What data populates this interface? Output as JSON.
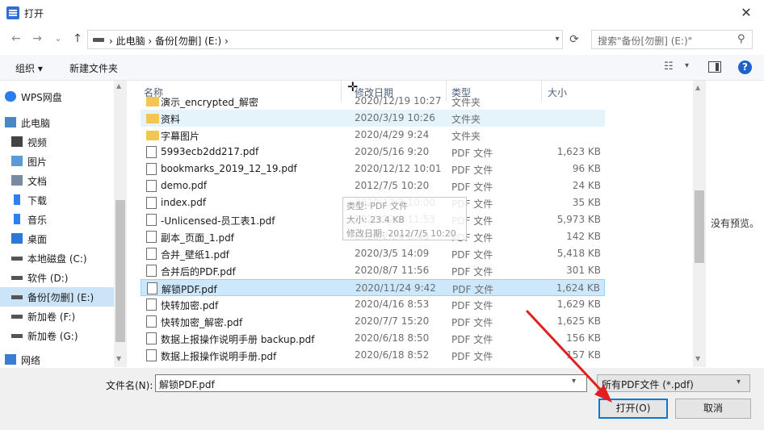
{
  "window": {
    "title": "打开",
    "close_glyph": "✕"
  },
  "nav": {
    "back_glyph": "←",
    "forward_glyph": "→",
    "recent_glyph": "⌄",
    "up_glyph": "↑",
    "breadcrumb": "›  此电脑  ›  备份[勿删] (E:)  ›",
    "search_placeholder": "搜索\"备份[勿删] (E:)\"",
    "refresh_glyph": "⟳"
  },
  "toolbar": {
    "organize": "组织 ▾",
    "new_folder": "新建文件夹"
  },
  "sidebar": {
    "items": [
      {
        "label": "WPS网盘",
        "icon": "cloud-icon"
      },
      {
        "label": "此电脑",
        "icon": "computer-icon"
      },
      {
        "label": "视频",
        "icon": "video-icon"
      },
      {
        "label": "图片",
        "icon": "pictures-icon"
      },
      {
        "label": "文档",
        "icon": "documents-icon"
      },
      {
        "label": "下载",
        "icon": "download-icon"
      },
      {
        "label": "音乐",
        "icon": "music-icon"
      },
      {
        "label": "桌面",
        "icon": "desktop-icon"
      },
      {
        "label": "本地磁盘 (C:)",
        "icon": "drive-icon"
      },
      {
        "label": "软件 (D:)",
        "icon": "drive-icon"
      },
      {
        "label": "备份[勿删] (E:)",
        "icon": "drive-icon"
      },
      {
        "label": "新加卷 (F:)",
        "icon": "drive-icon"
      },
      {
        "label": "新加卷 (G:)",
        "icon": "drive-icon"
      },
      {
        "label": "网络",
        "icon": "network-icon"
      }
    ]
  },
  "columns": {
    "name": "名称",
    "date": "修改日期",
    "type": "类型",
    "size": "大小"
  },
  "files": [
    {
      "name": "演示_encrypted_解密",
      "date": "2020/12/19 10:27",
      "type": "文件夹",
      "size": "",
      "kind": "folder"
    },
    {
      "name": "资料",
      "date": "2020/3/19 10:26",
      "type": "文件夹",
      "size": "",
      "kind": "folder"
    },
    {
      "name": "字幕图片",
      "date": "2020/4/29 9:24",
      "type": "文件夹",
      "size": "",
      "kind": "folder"
    },
    {
      "name": "5993ecb2dd217.pdf",
      "date": "2020/5/16 9:20",
      "type": "PDF 文件",
      "size": "1,623 KB",
      "kind": "doc"
    },
    {
      "name": "bookmarks_2019_12_19.pdf",
      "date": "2020/12/12 10:01",
      "type": "PDF 文件",
      "size": "96 KB",
      "kind": "doc"
    },
    {
      "name": "demo.pdf",
      "date": "2012/7/5 10:20",
      "type": "PDF 文件",
      "size": "24 KB",
      "kind": "doc"
    },
    {
      "name": "index.pdf",
      "date": "2020/12/2 10:00",
      "type": "PDF 文件",
      "size": "35 KB",
      "kind": "doc"
    },
    {
      "name": "-Unlicensed-员工表1.pdf",
      "date": "2020/12/3 11:53",
      "type": "PDF 文件",
      "size": "5,973 KB",
      "kind": "doc"
    },
    {
      "name": "副本_页面_1.pdf",
      "date": "2020/2/24 8:40",
      "type": "PDF 文件",
      "size": "142 KB",
      "kind": "doc"
    },
    {
      "name": "合并_壁纸1.pdf",
      "date": "2020/3/5 14:09",
      "type": "PDF 文件",
      "size": "5,418 KB",
      "kind": "doc"
    },
    {
      "name": "合并后的PDF.pdf",
      "date": "2020/8/7 11:56",
      "type": "PDF 文件",
      "size": "301 KB",
      "kind": "doc"
    },
    {
      "name": "解锁PDF.pdf",
      "date": "2020/11/24 9:42",
      "type": "PDF 文件",
      "size": "1,624 KB",
      "kind": "doc"
    },
    {
      "name": "快转加密.pdf",
      "date": "2020/4/16 8:53",
      "type": "PDF 文件",
      "size": "1,629 KB",
      "kind": "doc"
    },
    {
      "name": "快转加密_解密.pdf",
      "date": "2020/7/7 15:20",
      "type": "PDF 文件",
      "size": "1,625 KB",
      "kind": "doc"
    },
    {
      "name": "数据上报操作说明手册 backup.pdf",
      "date": "2020/6/18 8:50",
      "type": "PDF 文件",
      "size": "156 KB",
      "kind": "doc"
    },
    {
      "name": "数据上报操作说明手册.pdf",
      "date": "2020/6/18 8:52",
      "type": "PDF 文件",
      "size": "157 KB",
      "kind": "doc"
    }
  ],
  "tooltip": {
    "line1": "类型: PDF 文件",
    "line2": "大小: 23.4 KB",
    "line3": "修改日期: 2012/7/5 10:20"
  },
  "preview": {
    "no_preview": "没有预览。"
  },
  "bottom": {
    "filename_label": "文件名(N):",
    "filename_value": "解锁PDF.pdf",
    "filter_value": "所有PDF文件 (*.pdf)",
    "open_label": "打开(O)",
    "cancel_label": "取消"
  },
  "colors": {
    "accent": "#0078d7",
    "selection": "#cce8ff",
    "arrow": "#e02020"
  }
}
